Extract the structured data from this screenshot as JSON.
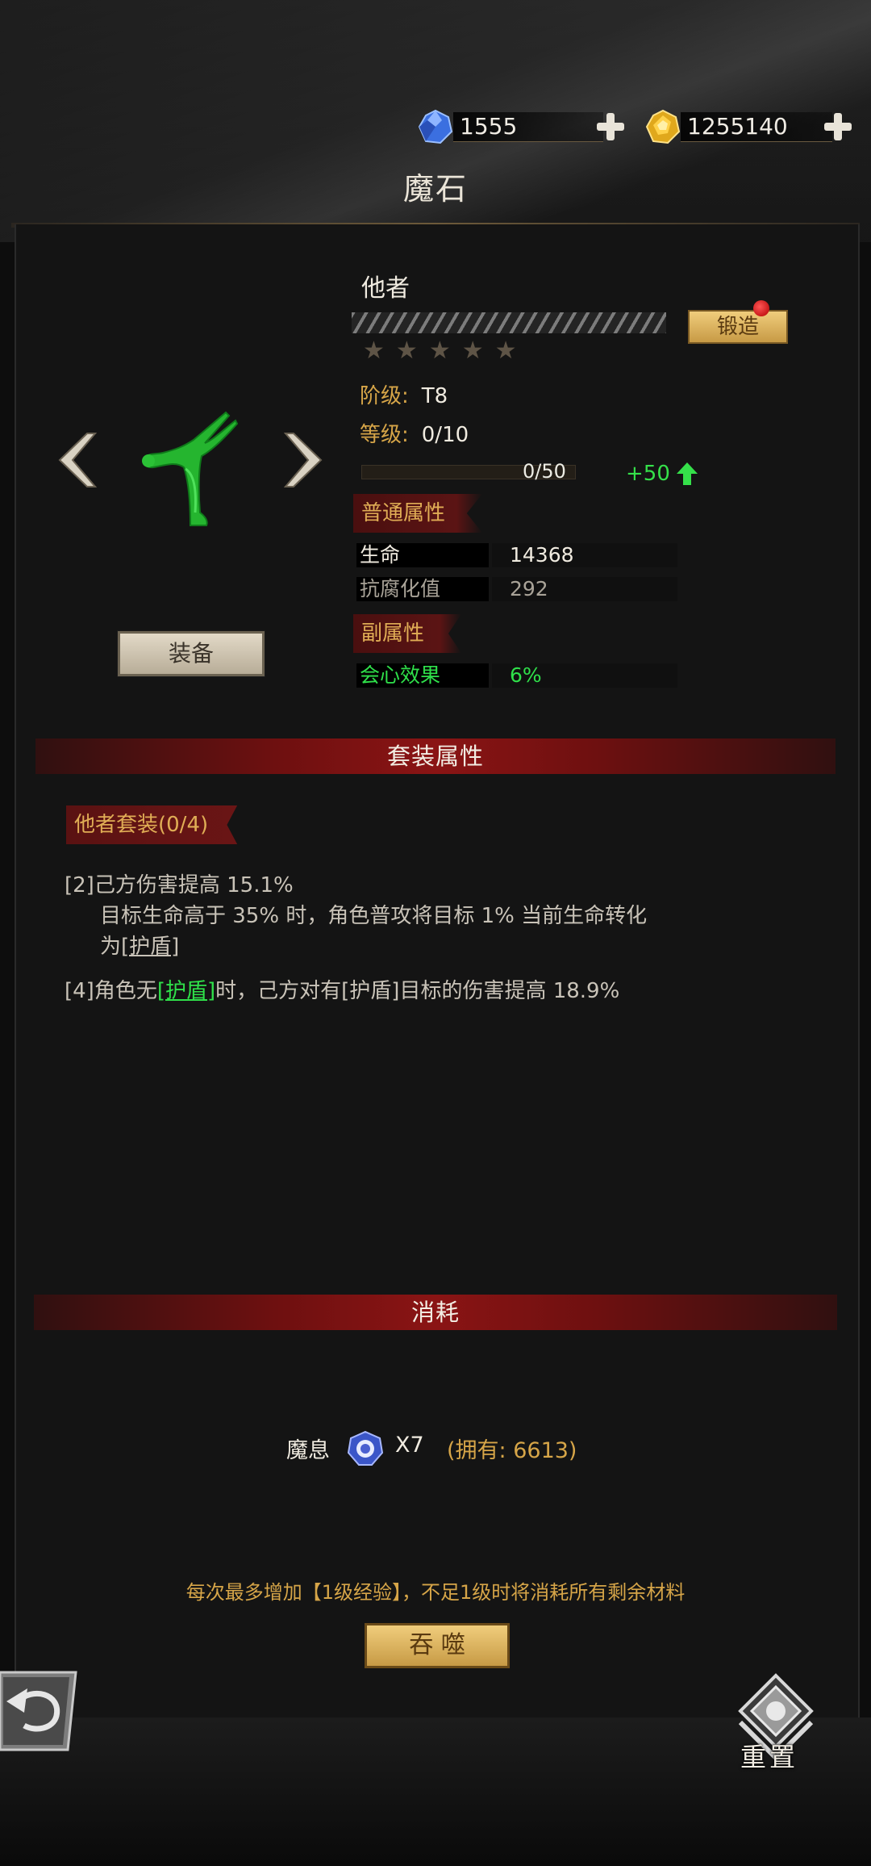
{
  "currencies": {
    "gems": {
      "value": "1555",
      "icon": "blue-gem-icon",
      "add_icon": "plus-icon"
    },
    "gold": {
      "value": "1255140",
      "icon": "gold-gem-icon",
      "add_icon": "plus-icon"
    }
  },
  "page_title": "魔石",
  "item": {
    "name": "他者",
    "forge_button": "锻造",
    "stars_total": 5,
    "stars_filled": 0,
    "tier_label": "阶级:",
    "tier_value": "T8",
    "level_label": "等级:",
    "level_value": "0/10",
    "xp_text": "0/50",
    "xp_progress": 0,
    "xp_gain": "+50",
    "equip_button": "装备"
  },
  "basic_attributes": {
    "title": "普通属性",
    "rows": [
      {
        "label": "生命",
        "value": "14368"
      },
      {
        "label": "抗腐化值",
        "value": "292"
      }
    ]
  },
  "sub_attributes": {
    "title": "副属性",
    "rows": [
      {
        "label": "会心效果",
        "value": "6%"
      }
    ]
  },
  "set_section": {
    "title": "套装属性",
    "set_name": "他者套装(0/4)",
    "effects": [
      {
        "tag": "[2]",
        "line1": "己方伤害提高 15.1%",
        "line2": "目标生命高于 35% 时，角色普攻将目标 1% 当前生命转化",
        "line3_prefix": "为",
        "line3_link": "[护盾]"
      },
      {
        "tag": "[4]",
        "pre": "角色无",
        "link": "[护盾]",
        "post": "时，己方对有[护盾]目标的伤害提高 18.9%"
      }
    ]
  },
  "consume_section": {
    "title": "消耗",
    "material_name": "魔息",
    "material_icon": "blue-orb-icon",
    "quantity": "X7",
    "owned": "(拥有: 6613)",
    "note": "每次最多增加【1级经验】，不足1级时将消耗所有剩余材料",
    "devour_button": "吞 噬"
  },
  "footer": {
    "reset_label": "重置"
  },
  "colors": {
    "gold_text": "#d6a548",
    "green_text": "#2fe04a",
    "ribbon_red": "#6e1010"
  }
}
